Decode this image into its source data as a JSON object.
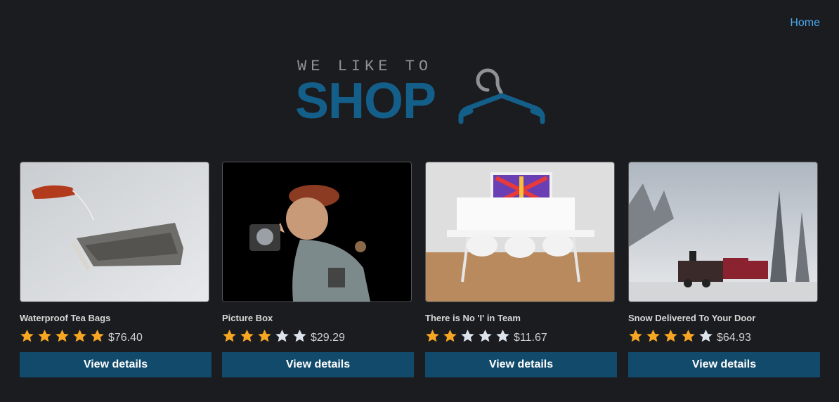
{
  "nav": {
    "home_label": "Home"
  },
  "logo": {
    "tagline": "WE LIKE TO",
    "title": "SHOP"
  },
  "colors": {
    "background": "#1b1c1f",
    "link": "#4aa8f0",
    "brand": "#135f8a",
    "button": "#114a6b",
    "star_filled": "#f6a623",
    "star_empty": "#dde3ea"
  },
  "products": [
    {
      "title": "Waterproof Tea Bags",
      "rating": 5,
      "max_rating": 5,
      "price": "$76.40",
      "button_label": "View details",
      "image": "tea-bag-photo"
    },
    {
      "title": "Picture Box",
      "rating": 3,
      "max_rating": 5,
      "price": "$29.29",
      "button_label": "View details",
      "image": "photographer-figurine-photo"
    },
    {
      "title": "There is No 'I' in Team",
      "rating": 2,
      "max_rating": 5,
      "price": "$11.67",
      "button_label": "View details",
      "image": "team-meeting-room-photo"
    },
    {
      "title": "Snow Delivered To Your Door",
      "rating": 4,
      "max_rating": 5,
      "price": "$64.93",
      "button_label": "View details",
      "image": "snow-train-photo"
    }
  ]
}
